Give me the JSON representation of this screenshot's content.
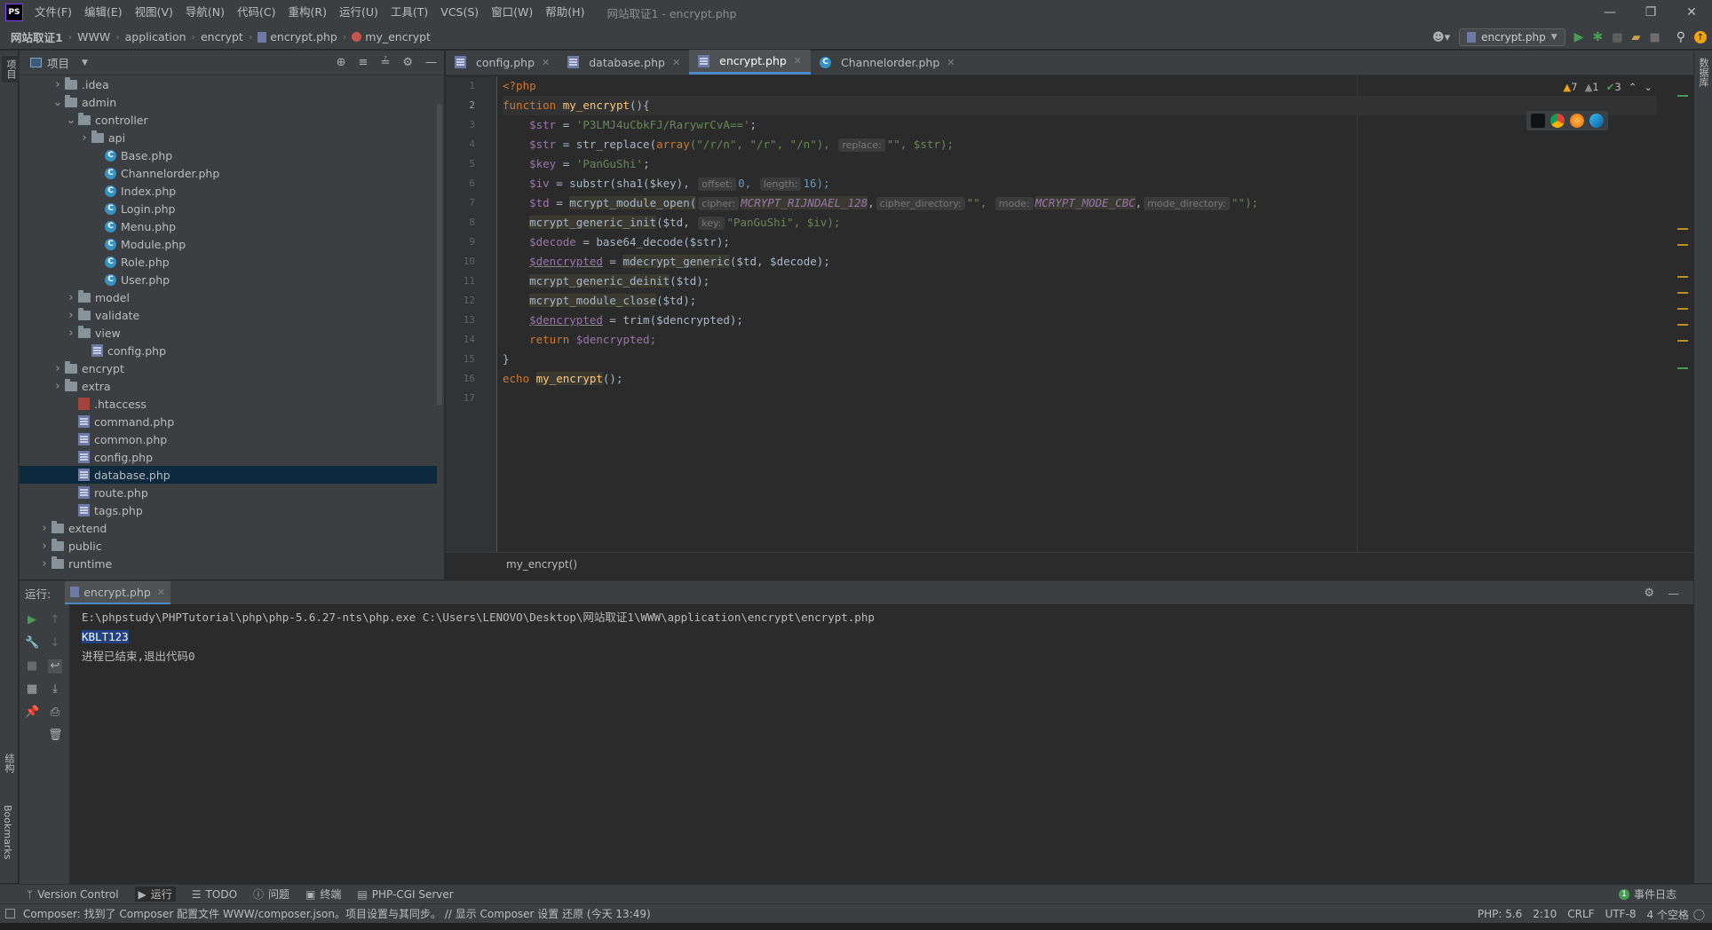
{
  "app": {
    "logo": "PS",
    "window_title": "网站取证1 - encrypt.php",
    "menu": [
      "文件(F)",
      "编辑(E)",
      "视图(V)",
      "导航(N)",
      "代码(C)",
      "重构(R)",
      "运行(U)",
      "工具(T)",
      "VCS(S)",
      "窗口(W)",
      "帮助(H)"
    ]
  },
  "breadcrumb": {
    "items": [
      "网站取证1",
      "WWW",
      "application",
      "encrypt",
      "encrypt.php",
      "my_encrypt"
    ]
  },
  "run_config": {
    "label": "encrypt.php"
  },
  "left_stripe": {
    "project_tab": "项目",
    "structure_tab": "结构",
    "bookmarks_tab": "Bookmarks"
  },
  "right_stripe": {
    "db_tab": "数据库"
  },
  "project_panel": {
    "title": "项目",
    "tree": [
      {
        "label": ".idea",
        "type": "folder",
        "depth": 3,
        "expanded": false
      },
      {
        "label": "admin",
        "type": "folder",
        "depth": 3,
        "expanded": true
      },
      {
        "label": "controller",
        "type": "folder",
        "depth": 4,
        "expanded": true
      },
      {
        "label": "api",
        "type": "folder",
        "depth": 5,
        "expanded": false
      },
      {
        "label": "Base.php",
        "type": "class",
        "depth": 6
      },
      {
        "label": "Channelorder.php",
        "type": "class",
        "depth": 6
      },
      {
        "label": "Index.php",
        "type": "class",
        "depth": 6
      },
      {
        "label": "Login.php",
        "type": "class",
        "depth": 6
      },
      {
        "label": "Menu.php",
        "type": "class",
        "depth": 6
      },
      {
        "label": "Module.php",
        "type": "class",
        "depth": 6
      },
      {
        "label": "Role.php",
        "type": "class",
        "depth": 6
      },
      {
        "label": "User.php",
        "type": "class",
        "depth": 6
      },
      {
        "label": "model",
        "type": "folder",
        "depth": 4,
        "expanded": false
      },
      {
        "label": "validate",
        "type": "folder",
        "depth": 4,
        "expanded": false
      },
      {
        "label": "view",
        "type": "folder",
        "depth": 4,
        "expanded": false
      },
      {
        "label": "config.php",
        "type": "php",
        "depth": 5
      },
      {
        "label": "encrypt",
        "type": "folder",
        "depth": 3,
        "expanded": false
      },
      {
        "label": "extra",
        "type": "folder",
        "depth": 3,
        "expanded": false
      },
      {
        "label": ".htaccess",
        "type": "htaccess",
        "depth": 4
      },
      {
        "label": "command.php",
        "type": "php",
        "depth": 4
      },
      {
        "label": "common.php",
        "type": "php",
        "depth": 4
      },
      {
        "label": "config.php",
        "type": "php",
        "depth": 4
      },
      {
        "label": "database.php",
        "type": "php",
        "depth": 4,
        "selected": true
      },
      {
        "label": "route.php",
        "type": "php",
        "depth": 4
      },
      {
        "label": "tags.php",
        "type": "php",
        "depth": 4
      },
      {
        "label": "extend",
        "type": "folder",
        "depth": 2,
        "expanded": false
      },
      {
        "label": "public",
        "type": "folder",
        "depth": 2,
        "expanded": false
      },
      {
        "label": "runtime",
        "type": "folder",
        "depth": 2,
        "expanded": false
      }
    ]
  },
  "editor": {
    "tabs": [
      {
        "label": "config.php",
        "icon": "php",
        "active": false
      },
      {
        "label": "database.php",
        "icon": "php",
        "active": false
      },
      {
        "label": "encrypt.php",
        "icon": "php",
        "active": true
      },
      {
        "label": "Channelorder.php",
        "icon": "class",
        "active": false
      }
    ],
    "inspections": {
      "warnings": "7",
      "weak_warnings": "1",
      "ok": "3"
    },
    "line_numbers": [
      "1",
      "2",
      "3",
      "4",
      "5",
      "6",
      "7",
      "8",
      "9",
      "10",
      "11",
      "12",
      "13",
      "14",
      "15",
      "16",
      "17"
    ],
    "code": {
      "l1": "<?php",
      "l2_kw": "function",
      "l2_fn": "my_encrypt",
      "l2_rest": "(){",
      "l3_var": "$str",
      "l3_str": "'P3LMJ4uCbkFJ/RarywrCvA=='",
      "l4_var": "$str",
      "l4_call": "str_replace(",
      "l4_kw": "array",
      "l4_args": "(\"/r/n\", \"/r\", \"/n\"),",
      "l4_hint": "replace:",
      "l4_tail": "\"\", $str);",
      "l5_var": "$key",
      "l5_str": "'PanGuShi'",
      "l6_var": "$iv",
      "l6_call": "substr(sha1($key),",
      "l6_hint1": "offset:",
      "l6_num1": "0,",
      "l6_hint2": "length:",
      "l6_num2": "16);",
      "l7_var": "$td",
      "l7_call": "mcrypt_module_open(",
      "l7_hint1": "cipher:",
      "l7_c1": "MCRYPT_RIJNDAEL_128",
      "l7_hint2": "cipher_directory:",
      "l7_s1": "\"\",",
      "l7_hint3": "mode:",
      "l7_c2": "MCRYPT_MODE_CBC",
      "l7_hint4": "mode_directory:",
      "l7_tail": "\"\");",
      "l8_call": "mcrypt_generic_init",
      "l8_args": "($td,",
      "l8_hint": "key:",
      "l8_tail": "\"PanGuShi\", $iv);",
      "l9_var": "$decode",
      "l9_call": "base64_decode($str);",
      "l10_var": "$dencrypted",
      "l10_call": "mdecrypt_generic",
      "l10_args": "($td, $decode);",
      "l11_call": "mcrypt_generic_deinit",
      "l11_args": "($td);",
      "l12_call": "mcrypt_module_close",
      "l12_args": "($td);",
      "l13_var": "$dencrypted",
      "l13_call": "trim($dencrypted);",
      "l14_kw": "return",
      "l14_var": "$dencrypted;",
      "l15": "}",
      "l16_kw": "echo",
      "l16_fn": "my_encrypt",
      "l16_rest": "();"
    },
    "crumb": "my_encrypt()"
  },
  "run_panel": {
    "label": "运行:",
    "tab": "encrypt.php",
    "output": [
      "E:\\phpstudy\\PHPTutorial\\php\\php-5.6.27-nts\\php.exe C:\\Users\\LENOVO\\Desktop\\网站取证1\\WWW\\application\\encrypt\\encrypt.php",
      "KBLT123",
      "进程已结束,退出代码0"
    ]
  },
  "tool_windows": [
    {
      "label": "Version Control",
      "icon": "branch-icon"
    },
    {
      "label": "运行",
      "icon": "play-icon",
      "active": true
    },
    {
      "label": "TODO",
      "icon": "list-icon"
    },
    {
      "label": "问题",
      "icon": "info-icon"
    },
    {
      "label": "终端",
      "icon": "terminal-icon"
    },
    {
      "label": "PHP-CGI Server",
      "icon": "server-icon"
    }
  ],
  "event_log": {
    "count": "1",
    "label": "事件日志"
  },
  "status": {
    "message": "Composer: 找到了 Composer 配置文件 WWW/composer.json。项目设置与其同步。 // 显示 Composer 设置  还原 (今天 13:49)",
    "php": "PHP: 5.6",
    "position": "2:10",
    "line_sep": "CRLF",
    "encoding": "UTF-8",
    "indent": "4 个空格"
  },
  "colors": {
    "accent": "#4a88c7",
    "keyword": "#cc7832",
    "string": "#6a8759",
    "variable": "#9876aa",
    "function": "#ffc66d",
    "number": "#6897bb",
    "selection": "#214283"
  }
}
